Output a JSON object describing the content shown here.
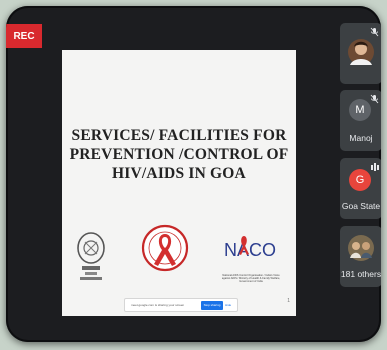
{
  "recording": {
    "label": "REC"
  },
  "slide": {
    "title_lines": [
      "SERVICES/ FACILITIES FOR",
      "PREVENTION /CONTROL OF",
      "HIV/AIDS IN GOA"
    ],
    "naco_logo_text": "NACO",
    "naco_caption": "National AIDS Control Organisation / India's Voice against AIDS / Ministry of Health & Family Welfare, Government of India",
    "share_bar": {
      "message": "meet.google.com is sharing your screen",
      "stop_label": "Stop sharing",
      "hide_label": "Hide"
    },
    "page_mark": "1"
  },
  "participants": [
    {
      "name": "",
      "avatar_type": "photo",
      "mic_muted": true
    },
    {
      "name": "Manoj",
      "avatar_letter": "M",
      "avatar_color": "#5f6368",
      "mic_muted": true
    },
    {
      "name": "Goa State",
      "avatar_letter": "G",
      "avatar_color": "#e8453c",
      "mic_muted": false
    },
    {
      "name": "181 others",
      "avatar_type": "group-photo"
    }
  ],
  "colors": {
    "rec_badge": "#d8292e",
    "tile_bg": "#3c4043",
    "frame_bg": "#1c1d20",
    "stop_button": "#1a73e8"
  }
}
